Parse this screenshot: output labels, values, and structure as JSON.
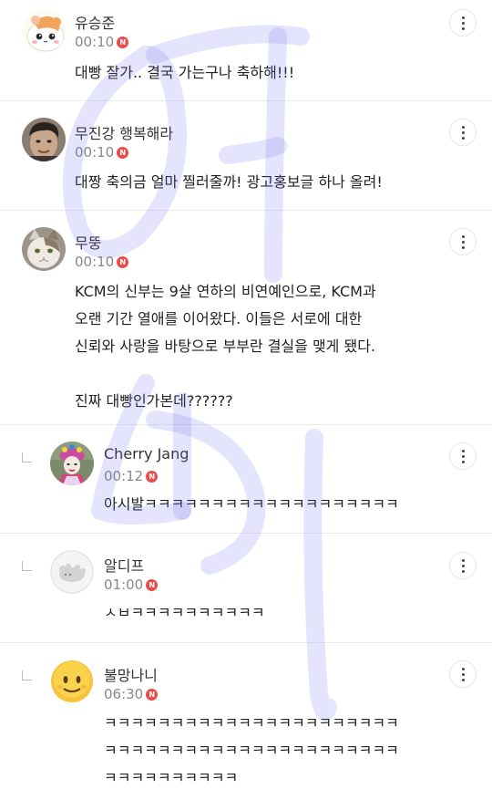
{
  "badge_letter": "N",
  "accent_color": "#e84c4c",
  "comments": [
    {
      "author": "유승준",
      "time": "00:10",
      "avatar": "hamster-avatar",
      "lines": [
        "대빵 잘가.. 결국 가는구나 축하해!!!"
      ]
    },
    {
      "author": "무진강 행복해라",
      "time": "00:10",
      "avatar": "person-photo-avatar",
      "lines": [
        "대짱 축의금 얼마 찔러줄까! 광고홍보글 하나 올려!"
      ]
    },
    {
      "author": "무뚱",
      "time": "00:10",
      "avatar": "cat-photo-avatar",
      "lines": [
        "KCM의 신부는 9살 연하의 비연예인으로, KCM과",
        "오랜 기간 열애를 이어왔다. 이들은 서로에 대한",
        "신뢰와 사랑을 바탕으로 부부란 결실을 맺게 됐다.",
        "",
        "진짜 대빵인가본데??????"
      ]
    }
  ],
  "replies": [
    {
      "author": "Cherry Jang",
      "time": "00:12",
      "avatar": "costume-photo-avatar",
      "lines": [
        "아시발ㅋㅋㅋㅋㅋㅋㅋㅋㅋㅋㅋㅋㅋㅋㅋㅋㅋㅋㅋ"
      ]
    },
    {
      "author": "알디프",
      "time": "01:00",
      "avatar": "default-profile-avatar",
      "lines": [
        "ㅅㅂㅋㅋㅋㅋㅋㅋㅋㅋㅋㅋ"
      ]
    },
    {
      "author": "불망나니",
      "time": "06:30",
      "avatar": "smiley-emoji-avatar",
      "lines": [
        "ㅋㅋㅋㅋㅋㅋㅋㅋㅋㅋㅋㅋㅋㅋㅋㅋㅋㅋㅋㅋㅋㅋ",
        "ㅋㅋㅋㅋㅋㅋㅋㅋㅋㅋㅋㅋㅋㅋㅋㅋㅋㅋㅋㅋㅋㅋ",
        "ㅋㅋㅋㅋㅋㅋㅋㅋㅋㅋ"
      ]
    }
  ]
}
